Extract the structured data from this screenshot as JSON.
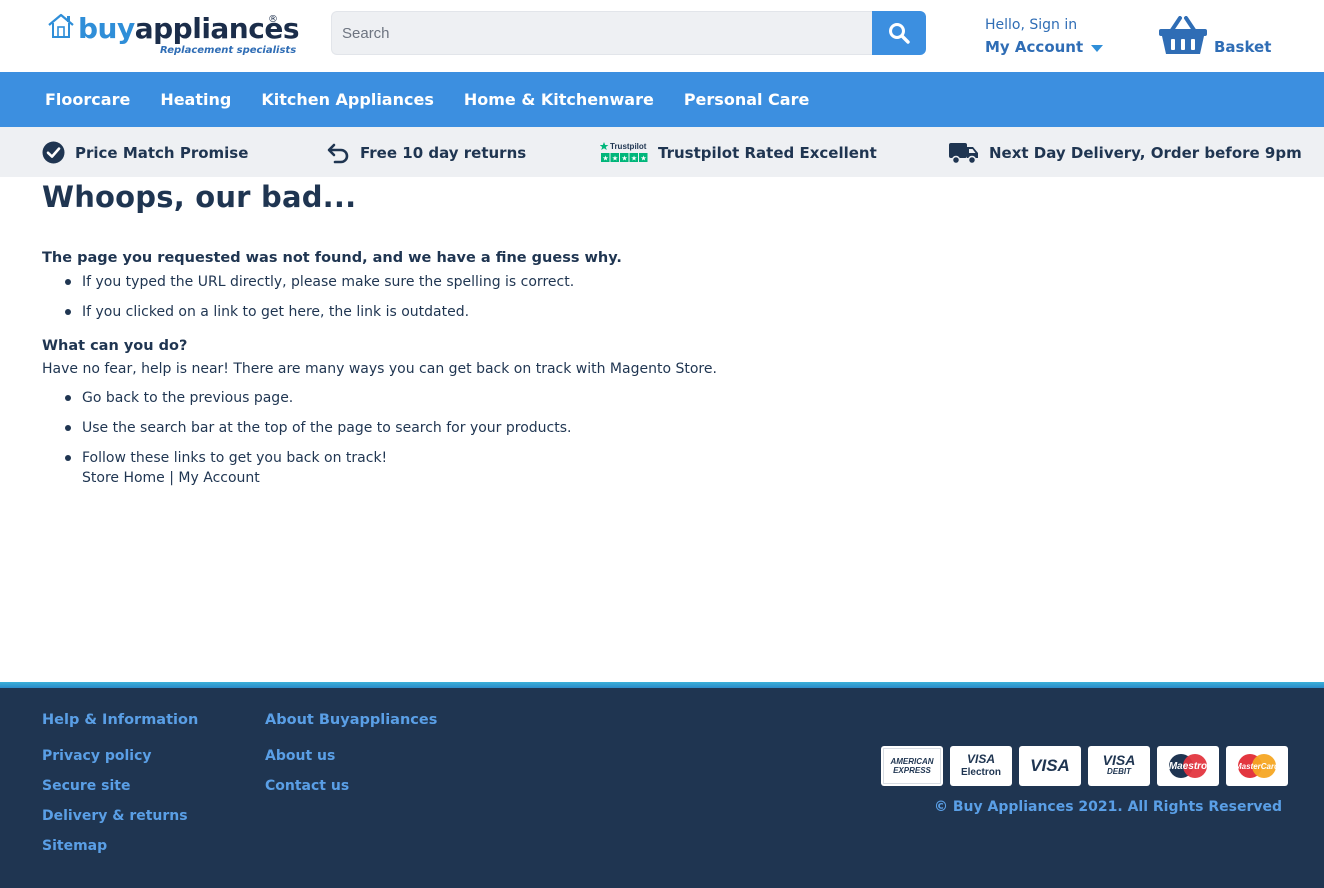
{
  "header": {
    "logo": {
      "part1": "buy",
      "part2": "appliances",
      "registered": "®",
      "tagline": "Replacement specialists"
    },
    "search": {
      "placeholder": "Search"
    },
    "account": {
      "greeting": "Hello, Sign in",
      "label": "My Account"
    },
    "basket": {
      "label": "Basket"
    }
  },
  "nav": {
    "items": [
      {
        "label": "Floorcare"
      },
      {
        "label": "Heating"
      },
      {
        "label": "Kitchen Appliances"
      },
      {
        "label": "Home & Kitchenware"
      },
      {
        "label": "Personal Care"
      }
    ]
  },
  "usp": {
    "items": [
      {
        "label": "Price Match Promise",
        "icon": "check-circle-icon"
      },
      {
        "label": "Free 10 day returns",
        "icon": "return-arrow-icon"
      },
      {
        "label": "Trustpilot Rated Excellent",
        "icon": "trustpilot-icon"
      },
      {
        "label": "Next Day Delivery, Order before 9pm",
        "icon": "truck-icon"
      }
    ],
    "trustpilot_wordmark": "Trustpilot"
  },
  "main": {
    "title": "Whoops, our bad...",
    "subhead": "The page you requested was not found, and we have a fine guess why.",
    "reasons": [
      "If you typed the URL directly, please make sure the spelling is correct.",
      "If you clicked on a link to get here, the link is outdated."
    ],
    "what_title": "What can you do?",
    "what_text": "Have no fear, help is near! There are many ways you can get back on track with Magento Store.",
    "actions": {
      "back_prefix": "Go ",
      "back_link": "back",
      "back_suffix": " to the previous page.",
      "search_text": "Use the search bar at the top of the page to search for your products.",
      "follow_text": "Follow these links to get you back on track!",
      "store_home": "Store Home",
      "separator": " | ",
      "my_account": "My Account"
    }
  },
  "footer": {
    "help_title": "Help & Information",
    "help_links": [
      "Privacy policy",
      "Secure site",
      "Delivery & returns",
      "Sitemap"
    ],
    "about_title": "About Buyappliances",
    "about_links": [
      "About us",
      "Contact us"
    ],
    "cards": {
      "amex_line1": "AMERICAN",
      "amex_line2": "EXPRESS",
      "electron_top": "VISA",
      "electron_bottom": "Electron",
      "visa": "VISA",
      "debit_top": "VISA",
      "debit_bottom": "DEBIT",
      "maestro": "Maestro",
      "mastercard": "MasterCard"
    },
    "copyright": "© Buy Appliances 2021. All Rights Reserved"
  },
  "colors": {
    "brand_blue": "#3c8fe0",
    "navy": "#1f3551",
    "footer_link": "#5a9fe6",
    "usp_bg": "#eef0f3"
  }
}
